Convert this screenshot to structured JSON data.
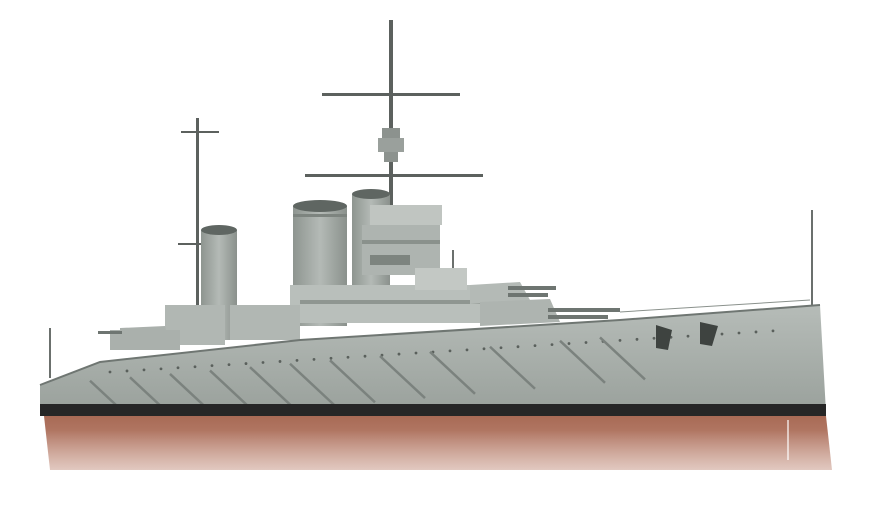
{
  "image": {
    "subject_icon": "battleship-illustration",
    "colors": {
      "background": "#ffffff",
      "hull_grey": "#a9afaa",
      "hull_grey_dark": "#7f8681",
      "hull_grey_light": "#c3c8c4",
      "boot_topping": "#262626",
      "waterline_red": "#a86a55",
      "waterline_red_dark": "#8a503e",
      "superstructure": "#b9bfbb",
      "mast": "#5c615e"
    }
  }
}
